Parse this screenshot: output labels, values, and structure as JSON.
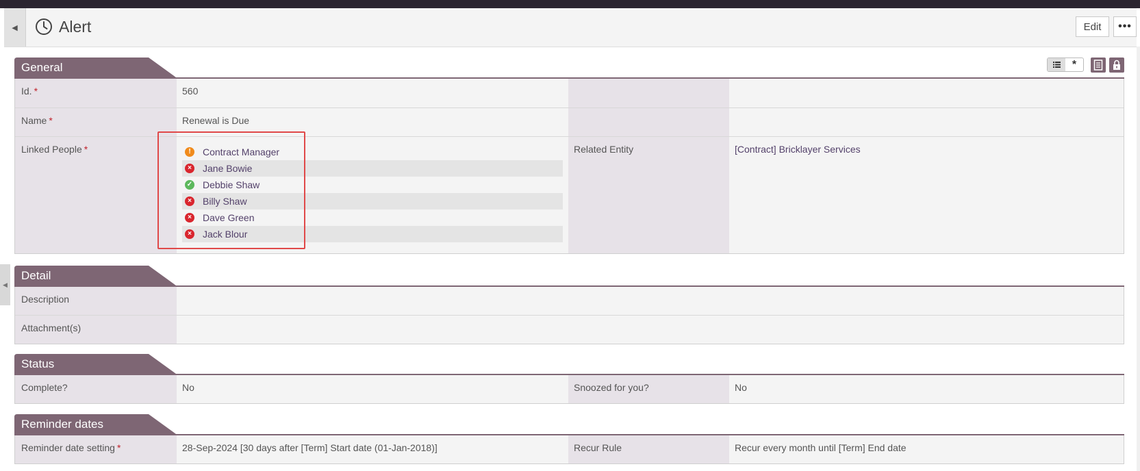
{
  "header": {
    "title": "Alert",
    "edit_label": "Edit",
    "more_label": "•••"
  },
  "toolbar": {
    "view_list_icon": "list-icon",
    "view_star_icon": "asterisk-icon",
    "star_glyph": "*"
  },
  "sections": {
    "general": {
      "title": "General",
      "id_label": "Id.",
      "id_value": "560",
      "name_label": "Name",
      "name_value": "Renewal is Due",
      "linked_label": "Linked People",
      "people": [
        {
          "name": "Contract Manager",
          "status": "warning"
        },
        {
          "name": "Jane Bowie",
          "status": "error"
        },
        {
          "name": "Debbie Shaw",
          "status": "ok"
        },
        {
          "name": "Billy Shaw",
          "status": "error"
        },
        {
          "name": "Dave Green",
          "status": "error"
        },
        {
          "name": "Jack Blour",
          "status": "error"
        }
      ],
      "related_label": "Related Entity",
      "related_value": "[Contract] Bricklayer Services"
    },
    "detail": {
      "title": "Detail",
      "description_label": "Description",
      "attachments_label": "Attachment(s)"
    },
    "status": {
      "title": "Status",
      "complete_label": "Complete?",
      "complete_value": "No",
      "snoozed_label": "Snoozed for you?",
      "snoozed_value": "No"
    },
    "reminder": {
      "title": "Reminder dates",
      "setting_label": "Reminder date setting",
      "setting_value": "28-Sep-2024 [30 days after [Term] Start date (01-Jan-2018)]",
      "recur_label": "Recur Rule",
      "recur_value": "Recur every month until [Term] End date"
    }
  },
  "required_mark": "*",
  "colors": {
    "section_tab": "#7e6674",
    "label_bg": "#e7e2e8",
    "highlight": "#e04848"
  }
}
